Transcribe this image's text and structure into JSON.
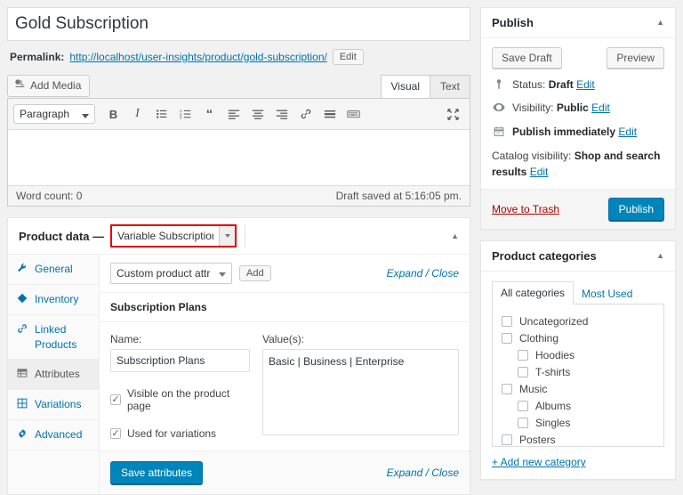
{
  "product": {
    "title": "Gold Subscription",
    "permalink_label": "Permalink:",
    "permalink_url": "http://localhost/user-insights/product/gold-subscription/",
    "permalink_edit": "Edit"
  },
  "editor": {
    "add_media": "Add Media",
    "tabs": [
      {
        "label": "Visual",
        "active": true
      },
      {
        "label": "Text",
        "active": false
      }
    ],
    "format_select": "Paragraph",
    "toolbar_icons": [
      "bold-icon",
      "italic-icon",
      "bulleted-list-icon",
      "numbered-list-icon",
      "blockquote-icon",
      "align-left-icon",
      "align-center-icon",
      "align-right-icon",
      "insert-link-icon",
      "read-more-icon",
      "keyboard-shortcuts-icon"
    ],
    "fullscreen_icon": "fullscreen-icon",
    "word_count": "Word count: 0",
    "draft_saved": "Draft saved at 5:16:05 pm."
  },
  "product_data": {
    "label": "Product data —",
    "type_selected": "Variable Subscription",
    "highlight_color": "#e10000",
    "toggle_icon": "chevron-up-icon",
    "tabs": [
      {
        "label": "General",
        "icon": "wrench-icon",
        "active": false
      },
      {
        "label": "Inventory",
        "icon": "tag-icon",
        "active": false
      },
      {
        "label": "Linked Products",
        "icon": "link-icon",
        "active": false
      },
      {
        "label": "Attributes",
        "icon": "table-icon",
        "active": true
      },
      {
        "label": "Variations",
        "icon": "grid-icon",
        "active": false
      },
      {
        "label": "Advanced",
        "icon": "gear-icon",
        "active": false
      }
    ],
    "attribute_source": "Custom product attribute",
    "add_button": "Add",
    "expand_close_top": "Expand / Close",
    "expand_close_bottom": "Expand / Close",
    "attribute": {
      "heading": "Subscription Plans",
      "name_label": "Name:",
      "name_value": "Subscription Plans",
      "values_label": "Value(s):",
      "values_value": "Basic | Business | Enterprise",
      "visible_label": "Visible on the product page",
      "visible_checked": true,
      "variations_label": "Used for variations",
      "variations_checked": true
    },
    "save_button": "Save attributes"
  },
  "publish": {
    "title": "Publish",
    "toggle_icon": "chevron-up-icon",
    "save_draft": "Save Draft",
    "preview": "Preview",
    "status_icon": "pin-icon",
    "status_label": "Status:",
    "status_value": "Draft",
    "status_edit": "Edit",
    "visibility_icon": "eye-icon",
    "visibility_label": "Visibility:",
    "visibility_value": "Public",
    "visibility_edit": "Edit",
    "schedule_icon": "calendar-icon",
    "schedule_value": "Publish immediately",
    "schedule_edit": "Edit",
    "catalog_label": "Catalog visibility:",
    "catalog_value": "Shop and search results",
    "catalog_edit": "Edit",
    "trash": "Move to Trash",
    "publish_button": "Publish",
    "accent_color": "#0085ba"
  },
  "categories": {
    "title": "Product categories",
    "toggle_icon": "chevron-up-icon",
    "tabs": [
      {
        "label": "All categories",
        "active": true
      },
      {
        "label": "Most Used",
        "active": false
      }
    ],
    "items": [
      {
        "label": "Uncategorized",
        "child": false,
        "checked": false
      },
      {
        "label": "Clothing",
        "child": false,
        "checked": false
      },
      {
        "label": "Hoodies",
        "child": true,
        "checked": false
      },
      {
        "label": "T-shirts",
        "child": true,
        "checked": false
      },
      {
        "label": "Music",
        "child": false,
        "checked": false
      },
      {
        "label": "Albums",
        "child": true,
        "checked": false
      },
      {
        "label": "Singles",
        "child": true,
        "checked": false
      },
      {
        "label": "Posters",
        "child": false,
        "checked": false
      }
    ],
    "add_new": "+ Add new category"
  }
}
